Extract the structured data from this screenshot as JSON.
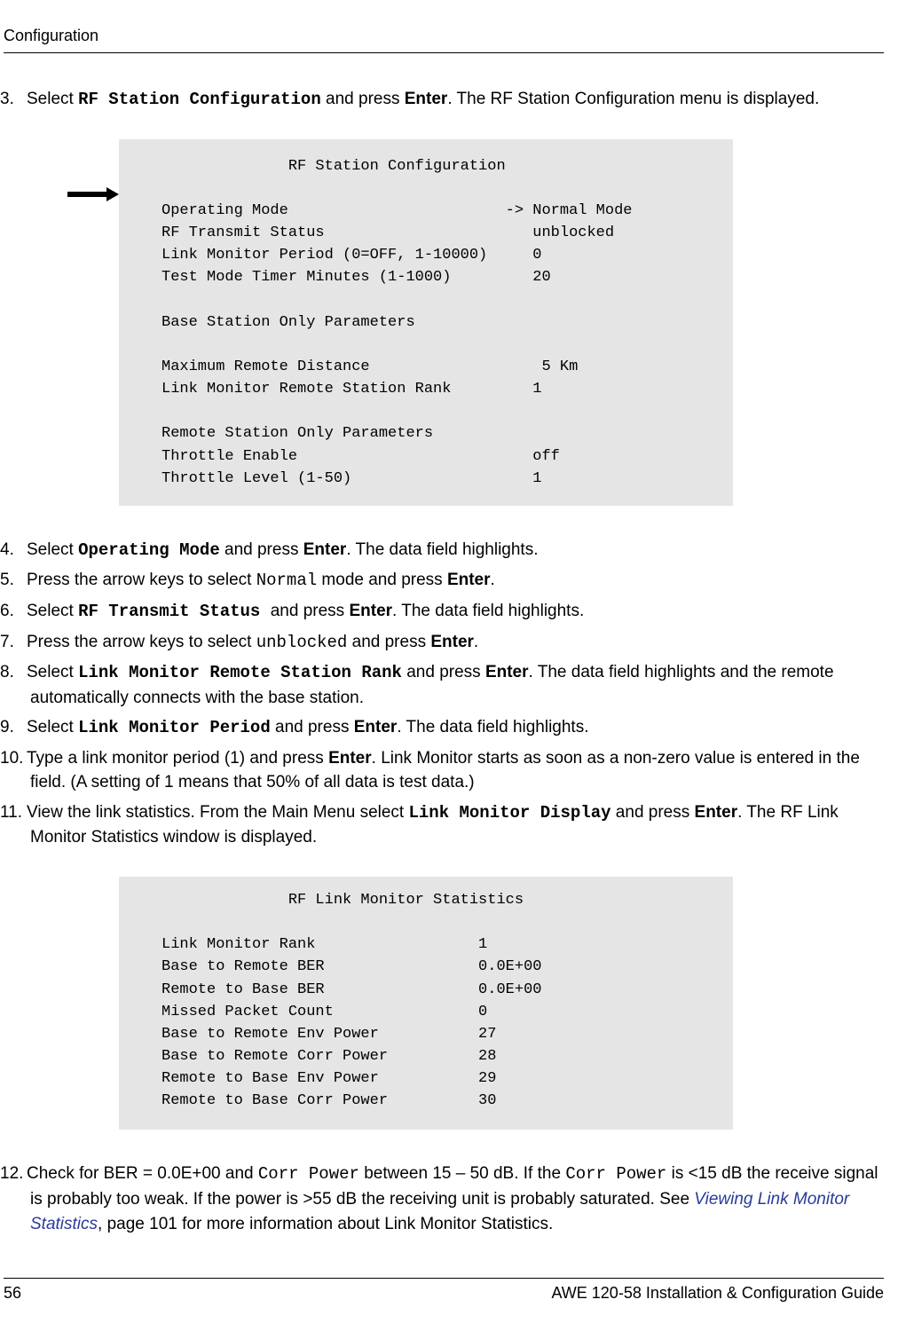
{
  "header": {
    "section": "Configuration"
  },
  "steps": {
    "s3": {
      "num": "3.",
      "t1": "Select ",
      "code1": "RF Station Configuration",
      "t2": " and press ",
      "bold1": "Enter",
      "t3": ". The RF Station Configuration menu is displayed."
    },
    "s4": {
      "num": "4.",
      "t1": "Select ",
      "code1": "Operating Mode",
      "t2": " and press ",
      "bold1": "Enter",
      "t3": ". The data field highlights."
    },
    "s5": {
      "num": "5.",
      "t1": "Press the arrow keys to select ",
      "code1": "Normal",
      "t2": " mode and press ",
      "bold1": "Enter",
      "t3": "."
    },
    "s6": {
      "num": "6.",
      "t1": "Select ",
      "code1": "RF Transmit Status ",
      "t2": "and press ",
      "bold1": "Enter",
      "t3": ". The data field highlights."
    },
    "s7": {
      "num": "7.",
      "t1": "Press the arrow keys to select ",
      "code1": "unblocked",
      "t2": " and press ",
      "bold1": "Enter",
      "t3": "."
    },
    "s8": {
      "num": "8.",
      "t1": "Select ",
      "code1": "Link Monitor Remote Station Rank",
      "t2": " and press ",
      "bold1": "Enter",
      "t3": ". The data field highlights and the remote automatically connects with the base station."
    },
    "s9": {
      "num": "9.",
      "t1": "Select ",
      "code1": "Link Monitor Period",
      "t2": " and press ",
      "bold1": "Enter",
      "t3": ". The data field highlights."
    },
    "s10": {
      "num": "10.",
      "t1": "Type a link monitor period (1) and press ",
      "bold1": "Enter",
      "t2": ". Link Monitor starts as soon as a non-zero value is entered in the field. (A setting of 1 means that 50% of all data is test data.)"
    },
    "s11": {
      "num": "11.",
      "t1": "View the link statistics. From the Main Menu select ",
      "code1": "Link Monitor Display",
      "t2": " and press ",
      "bold1": "Enter",
      "t3": ". The RF Link Monitor Statistics window is displayed."
    },
    "s12": {
      "num": "12.",
      "t1": "Check for BER = 0.0E+00 and ",
      "code1": "Corr Power",
      "t2": " between 15 – 50 dB. If the ",
      "code2": "Corr Power",
      "t3": " is <15 dB the receive signal is probably too weak. If the power is >55 dB the receiving unit is probably saturated. See ",
      "link1": "Viewing Link Monitor Statistics",
      "t4": ", page 101 for more information about Link Monitor Statistics."
    }
  },
  "terminal1": {
    "title": "              RF Station Configuration",
    "blank": "",
    "l1": "Operating Mode                        -> Normal Mode",
    "l2": "RF Transmit Status                       unblocked",
    "l3": "Link Monitor Period (0=OFF, 1-10000)     0",
    "l4": "Test Mode Timer Minutes (1-1000)         20",
    "l5": "Base Station Only Parameters",
    "l6": "Maximum Remote Distance                   5 Km",
    "l7": "Link Monitor Remote Station Rank         1",
    "l8": "Remote Station Only Parameters",
    "l9": "Throttle Enable                          off",
    "l10": "Throttle Level (1-50)                    1"
  },
  "terminal2": {
    "title": "              RF Link Monitor Statistics",
    "blank": "",
    "l1": "Link Monitor Rank                  1",
    "l2": "Base to Remote BER                 0.0E+00",
    "l3": "Remote to Base BER                 0.0E+00",
    "l4": "Missed Packet Count                0",
    "l5": "Base to Remote Env Power           27",
    "l6": "Base to Remote Corr Power          28",
    "l7": "Remote to Base Env Power           29",
    "l8": "Remote to Base Corr Power          30"
  },
  "footer": {
    "page": "56",
    "title": "AWE 120-58 Installation & Configuration Guide"
  }
}
